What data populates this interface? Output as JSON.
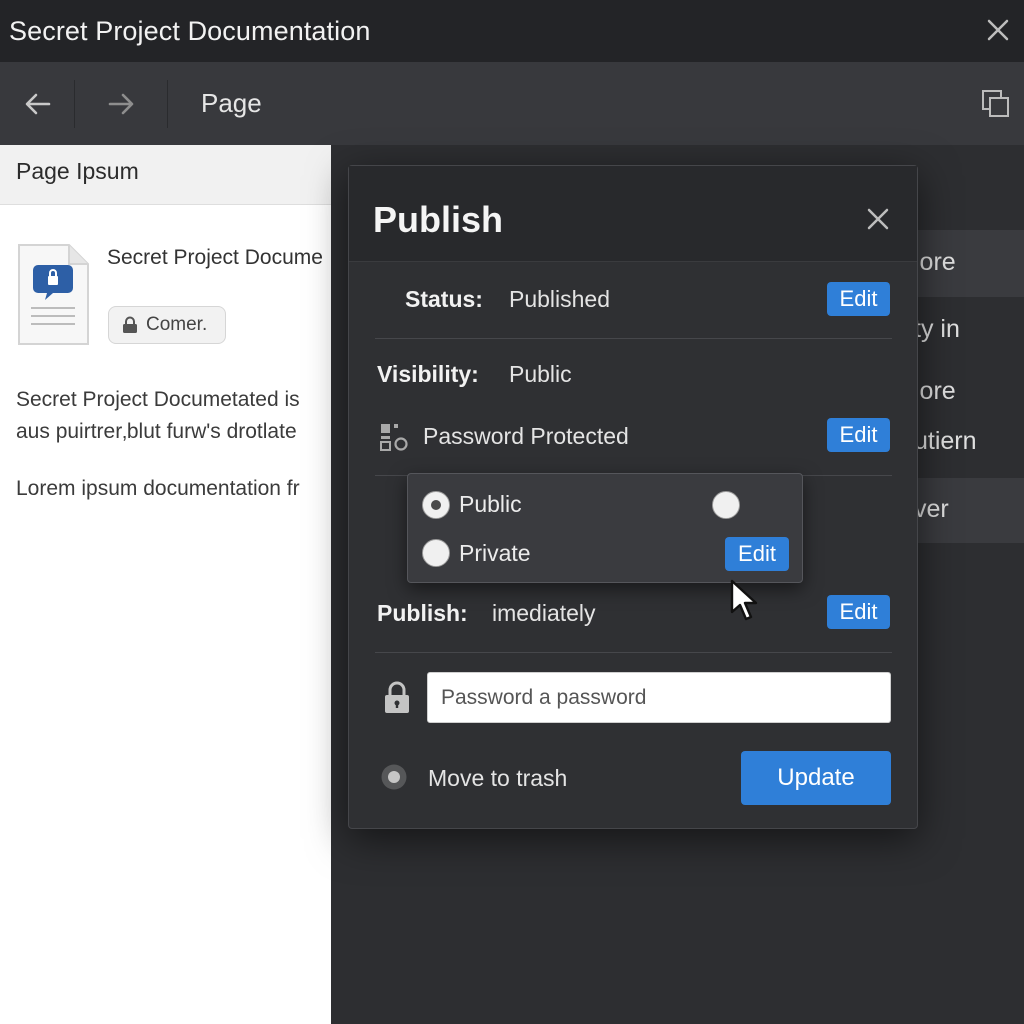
{
  "window": {
    "title": "Secret Project Documentation"
  },
  "toolbar": {
    "page_label": "Page"
  },
  "left_pane": {
    "header": "Page Ipsum",
    "doc_name": "Secret Project Docume",
    "chip_label": "Comer.",
    "para1_line1": "Secret Project Documetated is",
    "para1_line2": "aus puirtrer‚blut furw's drotlate",
    "para2": "Lorem ipsum documentation fr"
  },
  "right_strip": [
    "lore",
    "ty in",
    "lore",
    "utiern",
    "ver"
  ],
  "modal": {
    "title": "Publish",
    "status": {
      "label": "Status:",
      "value": "Published",
      "edit": "Edit"
    },
    "visibility": {
      "label": "Visibility:",
      "value": "Public"
    },
    "password_protected": {
      "label": "Password Protected",
      "edit": "Edit"
    },
    "visibility_options": [
      {
        "label": "Public",
        "checked": true
      },
      {
        "label": "Private",
        "checked": false
      }
    ],
    "popover_edit": "Edit",
    "publish": {
      "label": "Publish:",
      "value": "imediately",
      "edit": "Edit"
    },
    "password_input": {
      "placeholder": "Password a password",
      "value": ""
    },
    "move_to_trash": "Move to trash",
    "update": "Update"
  },
  "colors": {
    "accent": "#2f7fd8",
    "modal_bg": "#2f3033",
    "title_bg": "#232427"
  }
}
